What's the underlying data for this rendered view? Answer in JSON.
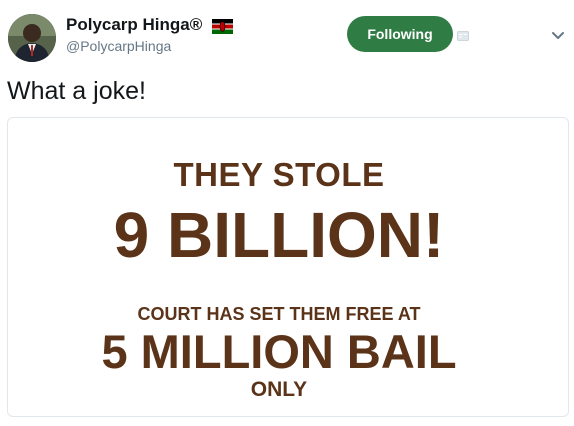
{
  "author": {
    "name": "Polycarp Hinga®",
    "handle": "@PolycarpHinga",
    "flag_icon": "kenya-flag-icon"
  },
  "actions": {
    "follow_label": "Following",
    "follow_color": "#2f7d45",
    "translate_icon": "translate-icon",
    "menu_icon": "chevron-down-icon"
  },
  "tweet": {
    "text": "What a joke!"
  },
  "media": {
    "line1": "THEY STOLE",
    "line2": "9 BILLION!",
    "line3": "COURT HAS SET THEM FREE AT",
    "line4": "5 MILLION BAIL",
    "line5": "ONLY",
    "text_color": "#5b3318"
  }
}
